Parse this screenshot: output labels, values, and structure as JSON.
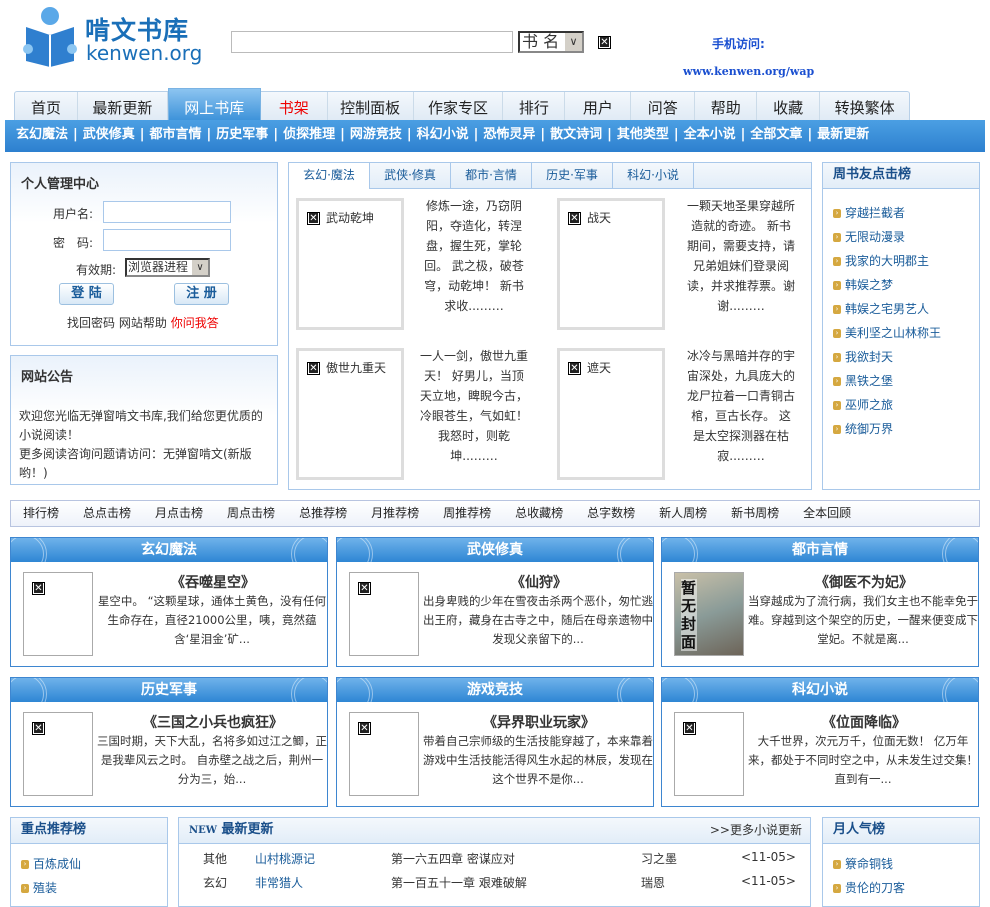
{
  "header": {
    "logo_title": "啃文书库",
    "logo_sub": "kenwen.org",
    "search_value": "",
    "search_type": "书 名",
    "mobile_label": "手机访问:",
    "wap_url": "www.kenwen.org/wap"
  },
  "nav": {
    "tabs": [
      "首页",
      "最新更新",
      "网上书库",
      "书架",
      "控制面板",
      "作家专区",
      "排行",
      "用户",
      "问答",
      "帮助",
      "收藏",
      "转换繁体"
    ]
  },
  "categories": [
    "玄幻魔法",
    "武侠修真",
    "都市言情",
    "历史军事",
    "侦探推理",
    "网游竞技",
    "科幻小说",
    "恐怖灵异",
    "散文诗词",
    "其他类型",
    "全本小说",
    "全部文章",
    "最新更新"
  ],
  "login": {
    "title": "个人管理中心",
    "username_label": "用户名:",
    "password_label": "密　码:",
    "expiry_label": "有效期:",
    "expiry_value": "浏览器进程",
    "login_btn": "登 陆",
    "register_btn": "注 册",
    "links": [
      "找回密码",
      "网站帮助",
      "你问我答"
    ]
  },
  "notice": {
    "title": "网站公告",
    "line1": "欢迎您光临无弹窗啃文书库,我们给您更优质的小说阅读！",
    "line2": "更多阅读咨询问题请访问：无弹窗啃文(新版哟！)"
  },
  "featured": {
    "tabs": [
      "玄幻·魔法",
      "武侠·修真",
      "都市·言情",
      "历史·军事",
      "科幻·小说"
    ],
    "books": [
      {
        "title": "武动乾坤",
        "desc": "修炼一途，乃窃阴阳，夺造化，转涅盘，握生死，掌轮回。 武之极，破苍穹，动乾坤！ 新书求收...……"
      },
      {
        "title": "战天",
        "desc": "一颗天地圣果穿越所造就的奇迹。 新书期间，需要支持，请兄弟姐妹们登录阅读，并求推荐票。谢谢...……"
      },
      {
        "title": "傲世九重天",
        "desc": "一人一剑，傲世九重天！ 好男儿，当顶天立地，睥睨今古，冷眼苍生，气如虹！我怒时，则乾坤...……"
      },
      {
        "title": "遮天",
        "desc": "冰冷与黑暗并存的宇宙深处，九具庞大的龙尸拉着一口青铜古棺，亘古长存。 这是太空探测器在枯寂...……"
      }
    ]
  },
  "weekly": {
    "title": "周书友点击榜",
    "items": [
      "穿越拦截者",
      "无限动漫录",
      "我家的大明郡主",
      "韩娱之梦",
      "韩娱之宅男艺人",
      "美利坚之山林称王",
      "我欲封天",
      "黑铁之堡",
      "巫师之旅",
      "统御万界"
    ]
  },
  "ranks": [
    "排行榜",
    "总点击榜",
    "月点击榜",
    "周点击榜",
    "总推荐榜",
    "月推荐榜",
    "周推荐榜",
    "总收藏榜",
    "总字数榜",
    "新人周榜",
    "新书周榜",
    "全本回顾"
  ],
  "cat_boxes": [
    {
      "name": "玄幻魔法",
      "title": "《吞噬星空》",
      "desc": "星空中。 “这颗星球，通体土黄色，没有任何生命存在，直径21000公里，咦，竟然蕴含‘星泪金’矿...",
      "cover": ""
    },
    {
      "name": "武侠修真",
      "title": "《仙狩》",
      "desc": "出身卑贱的少年在雪夜击杀两个恶仆，匆忙逃出王府，藏身在古寺之中，随后在母亲遗物中发现父亲留下的...",
      "cover": ""
    },
    {
      "name": "都市言情",
      "title": "《御医不为妃》",
      "desc": "当穿越成为了流行病，我们女主也不能幸免于难。穿越到这个架空的历史，一醒来便变成下堂妃。不就是离...",
      "cover": "暂无封面"
    },
    {
      "name": "历史军事",
      "title": "《三国之小兵也疯狂》",
      "desc": "三国时期，天下大乱，名将多如过江之鲫，正是我辈风云之时。 自赤壁之战之后，荆州一分为三，始...",
      "cover": ""
    },
    {
      "name": "游戏竞技",
      "title": "《异界职业玩家》",
      "desc": "带着自己宗师级的生活技能穿越了，本来靠着游戏中生活技能活得风生水起的林辰，发现在这个世界不是你...",
      "cover": ""
    },
    {
      "name": "科幻小说",
      "title": "《位面降临》",
      "desc": "大千世界，次元万千，位面无数！ 亿万年来，都处于不同时空之中，从未发生过交集！ 直到有一...",
      "cover": ""
    }
  ],
  "recommend": {
    "title": "重点推荐榜",
    "items": [
      "百炼成仙",
      "殖装"
    ]
  },
  "updates": {
    "badge": "NEW",
    "title": "最新更新",
    "more": ">>更多小说更新",
    "rows": [
      {
        "type": "其他",
        "book": "山村桃源记",
        "chapter": "第一六五四章 密谋应对",
        "author": "习之墨",
        "date": "<11-05>"
      },
      {
        "type": "玄幻",
        "book": "非常猎人",
        "chapter": "第一百五十一章 艰难破解",
        "author": "瑞恩",
        "date": "<11-05>"
      }
    ]
  },
  "monthly": {
    "title": "月人气榜",
    "items": [
      "簝命铜钱",
      "贵伦的刀客"
    ]
  }
}
